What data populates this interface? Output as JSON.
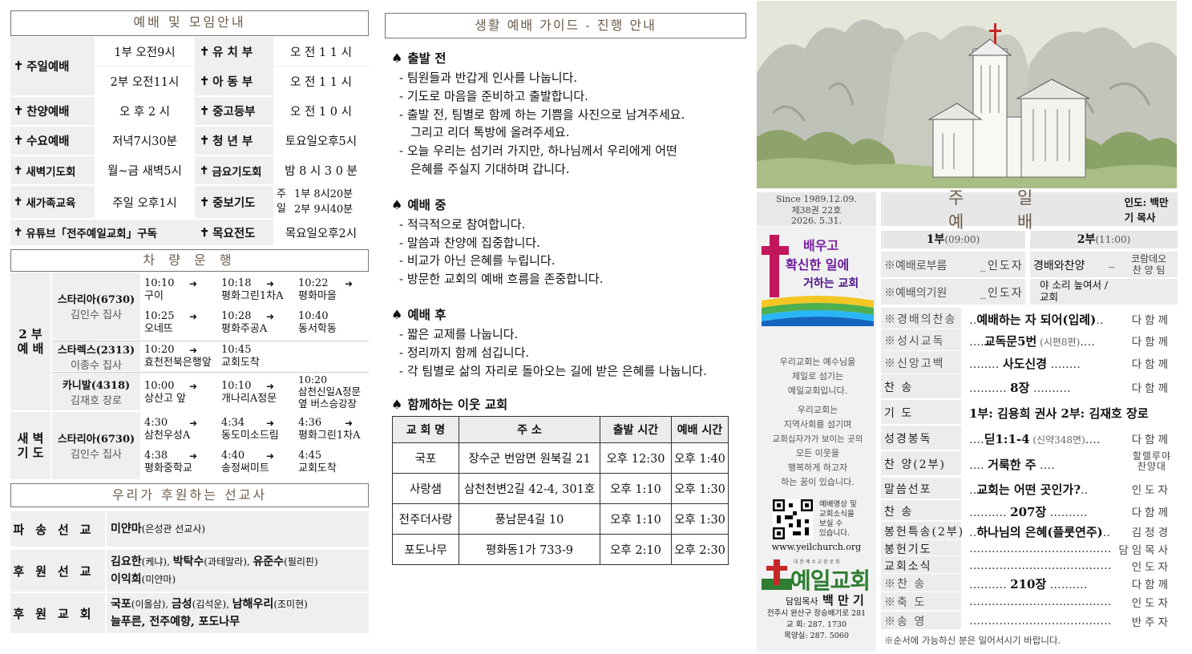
{
  "schedule": {
    "title": "예배 및 모임안내",
    "rows": [
      {
        "a_label": "주일예배",
        "a_val1": "1부  오전9시",
        "a_val2": "2부  오전11시",
        "b1_label": "유 치 부",
        "b1_val": "오 전 1 1 시",
        "b2_label": "아 동 부",
        "b2_val": "오 전 1 1 시"
      },
      {
        "a_label": "찬양예배",
        "a_val": "오  후  2  시",
        "b_label": "중고등부",
        "b_val": "오 전 1 0 시"
      },
      {
        "a_label": "수요예배",
        "a_val": "저녁7시30분",
        "b_label": "청 년 부",
        "b_val": "토요일오후5시"
      },
      {
        "a_label": "새벽기도회",
        "a_val": "월~금 새벽5시",
        "b_label": "금요기도회",
        "b_val": "밤 8 시 3 0 분"
      },
      {
        "a_label": "새가족교육",
        "a_val": "주일  오후1시",
        "b_label": "중보기도",
        "b_val_left": "주일",
        "b_val1": "1부  8시20분",
        "b_val2": "2부  9시40분"
      },
      {
        "a_label": "유튜브「전주예일교회」구독",
        "b_label": "목요전도",
        "b_val": "목요일오후2시"
      }
    ],
    "cross": "✝"
  },
  "bus": {
    "title": "차 량 운 행",
    "arrow": "➜",
    "section1_label": "2 부\n예 배",
    "section2_label": "새 벽\n기 도",
    "routes": [
      {
        "car": "스타리아(6730)",
        "driver": "김인수 집사",
        "stops": [
          [
            "10:10",
            "구이"
          ],
          [
            "10:18",
            "평화그린1차A"
          ],
          [
            "10:22",
            "평화마을"
          ],
          [
            "10:25",
            "오네뜨"
          ],
          [
            "10:28",
            "평화주공A"
          ],
          [
            "10:40",
            "동서학동"
          ]
        ]
      },
      {
        "car": "스타렉스(2313)",
        "driver": "이종수 집사",
        "stops": [
          [
            "10:20",
            "효천전북은행앞"
          ],
          [
            "10:45",
            "교회도착"
          ]
        ]
      },
      {
        "car": "카니발(4318)",
        "driver": "김재호 장로",
        "stops": [
          [
            "10:00",
            "상산고 앞"
          ],
          [
            "10:10",
            "개나리A정문"
          ],
          [
            "10:20",
            "삼천신일A정문 옆 버스승강장"
          ]
        ]
      },
      {
        "car": "스타리아(6730)",
        "driver": "김인수 집사",
        "stops": [
          [
            "4:30",
            "삼천우성A"
          ],
          [
            "4:34",
            "동도미소드림"
          ],
          [
            "4:36",
            "평화그린1차A"
          ],
          [
            "4:38",
            "평화중학교"
          ],
          [
            "4:40",
            "송정써미트"
          ],
          [
            "4:45",
            "교회도착"
          ]
        ]
      }
    ]
  },
  "missionaries": {
    "title": "우리가 후원하는 선교사",
    "rows": [
      {
        "label": "파송선교",
        "html_lines": [
          [
            [
              "미얀마",
              true
            ],
            [
              "(은성관 선교사)",
              false
            ]
          ]
        ]
      },
      {
        "label": "후원선교",
        "html_lines": [
          [
            [
              "김요한",
              true
            ],
            [
              "(케냐), ",
              false
            ],
            [
              "박탁수",
              true
            ],
            [
              "(과테말라), ",
              false
            ],
            [
              "유준수",
              true
            ],
            [
              "(필리핀)",
              false
            ]
          ],
          [
            [
              "이익희",
              true
            ],
            [
              "(미얀마)",
              false
            ]
          ]
        ]
      },
      {
        "label": "후원교회",
        "html_lines": [
          [
            [
              "국포",
              true
            ],
            [
              "(이올삼), ",
              false
            ],
            [
              "금성",
              true
            ],
            [
              "(김석운), ",
              false
            ],
            [
              "남해우리",
              true
            ],
            [
              "(조미현)",
              false
            ]
          ],
          [
            [
              "늘푸른, 전주예향, 포도나무",
              true
            ]
          ]
        ]
      }
    ]
  },
  "guide": {
    "title": "생활 예배 가이드 - 진행 안내",
    "spade": "♠",
    "sections": [
      {
        "head": "출발 전",
        "lines": [
          "- 팀원들과 반갑게 인사를 나눕니다.",
          "- 기도로 마음을 준비하고 출발합니다.",
          "- 출발 전, 팀별로 함께 하는 기쁨을 사진으로 남겨주세요.",
          "그리고 리더 톡방에 올려주세요.",
          "- 오늘 우리는 섬기러 가지만, 하나님께서 우리에게 어떤",
          "은혜를 주실지 기대하며 갑니다."
        ]
      },
      {
        "head": "예배 중",
        "lines": [
          "- 적극적으로 참여합니다.",
          "- 말씀과 찬양에 집중합니다.",
          "- 비교가 아닌 은혜를 누립니다.",
          "- 방문한 교회의 예배 흐름을 존중합니다."
        ]
      },
      {
        "head": "예배 후",
        "lines": [
          "- 짧은 교제를 나눕니다.",
          "- 정리까지 함께 섬깁니다.",
          "- 각 팀별로 삶의 자리로 돌아오는 길에 받은 은혜를 나눕니다."
        ]
      },
      {
        "head": "함께하는 이웃 교회",
        "lines": []
      }
    ],
    "table": {
      "headers": [
        "교 회 명",
        "주    소",
        "출발 시간",
        "예배 시간"
      ],
      "rows": [
        [
          "국포",
          "장수군 번암면 원북길 21",
          "오후 12:30",
          "오후 1:40"
        ],
        [
          "사랑샘",
          "삼천천변2길 42-4, 301호",
          "오후 1:10",
          "오후 1:30"
        ],
        [
          "전주더사랑",
          "풍남문4길 10",
          "오후 1:10",
          "오후 1:30"
        ],
        [
          "포도나무",
          "평화동1가 733-9",
          "오후 2:10",
          "오후 2:30"
        ]
      ]
    }
  },
  "bulletin": {
    "since": "Since 1989.12.09.",
    "volume": "제38권 22호",
    "date": "2026. 5.31.",
    "slogan_l1": "배우고",
    "slogan_l2": "확신한 일에",
    "slogan_l3": "거하는 교회",
    "intro": [
      "우리교회는 예수님을",
      "제일로 섬기는",
      "예일교회입니다.",
      "우리교회는",
      "지역사회를 섬기며",
      "교회십자가가 보이는 곳의",
      "모든 이웃을",
      "행복하게 하고자",
      "하는 꿈이 있습니다."
    ],
    "qr_text": [
      "예배영상 및",
      "교회소식을",
      "보실 수",
      "있습니다."
    ],
    "url": "www.yeilchurch.org",
    "church_sub": "대 한 예 수 교 장 로 회",
    "church_name": "예일교회",
    "pastor_label": "담임목사",
    "pastor_name": "백 만 기",
    "address": "전주시 완산구 장승배기로 281",
    "tel_church": "교    회:  287. 1730",
    "tel_pastor": "목양실:  287. 5060"
  },
  "order": {
    "title": "주 일 예 배",
    "leader": "인도: 백만기 목사",
    "part1": "1부",
    "part1_time": "(09:00)",
    "part2": "2부",
    "part2_time": "(11:00)",
    "r1_name": "※예배로부름",
    "r1_who": "_인도자",
    "r1_name2": "경배와찬양",
    "r1_dash": "_",
    "r1_who2a": "코람데오",
    "r1_who2b": "찬 양 팀",
    "r2_name": "※예배의기원",
    "r2_who": "_인도자",
    "r2_text_a": "야 소리 높여서 /",
    "r2_text_b": "교회",
    "items": [
      {
        "name": "※경배의찬송",
        "pre": "‥",
        "content": "예배하는 자 되어(입례)",
        "sub": "",
        "post": "‥",
        "who": "다함께"
      },
      {
        "name": "※성시교독",
        "pre": "‥‥",
        "content": "교독문5번",
        "sub": " (시편8편)",
        "post": "‥‥",
        "who": "다함께"
      },
      {
        "name": "※신앙고백",
        "pre": "‥‥‥‥ ",
        "content": "사도신경",
        "sub": "",
        "post": " ‥‥‥‥",
        "who": "다함께"
      },
      {
        "name": "찬        송",
        "pre": "‥‥‥‥‥  ",
        "content": "8장",
        "sub": "",
        "post": "  ‥‥‥‥‥",
        "who": "다함께"
      },
      {
        "name": "기        도",
        "pre": "",
        "content": "1부: 김용희 권사    2부: 김재호 장로",
        "sub": "",
        "post": "",
        "who": ""
      },
      {
        "name": "성경봉독",
        "pre": "‥‥",
        "content": "딛1:1-4",
        "sub": " (신약348면)",
        "post": "‥‥",
        "who": "다함께"
      },
      {
        "name": "찬  양(2부)",
        "pre": "‥‥ ",
        "content": "거룩한  주",
        "sub": "",
        "post": " ‥‥",
        "who": "할렐루야\n찬양대"
      },
      {
        "name": "말씀선포",
        "pre": "‥",
        "content": "교회는 어떤 곳인가?",
        "sub": "",
        "post": "‥",
        "who": "인도자"
      },
      {
        "name": "찬        송",
        "pre": "‥‥‥‥‥  ",
        "content": "207장",
        "sub": "",
        "post": "  ‥‥‥‥‥",
        "who": "다함께"
      },
      {
        "name": "봉헌특송(2부)",
        "pre": "‥",
        "content": "하나님의 은혜(플룻연주)",
        "sub": "",
        "post": "‥",
        "who": "김정경"
      },
      {
        "name": "봉헌기도",
        "pre": "‥‥‥‥‥‥‥‥‥‥‥‥‥‥‥‥‥‥‥",
        "content": "",
        "sub": "",
        "post": "",
        "who": "담임목사"
      },
      {
        "name": "교회소식",
        "pre": "‥‥‥‥‥‥‥‥‥‥‥‥‥‥‥‥‥‥‥",
        "content": "",
        "sub": "",
        "post": "",
        "who": "인도자"
      },
      {
        "name": "※찬        송",
        "pre": "‥‥‥‥‥  ",
        "content": "210장",
        "sub": "",
        "post": "  ‥‥‥‥‥",
        "who": "다함께"
      },
      {
        "name": "※축        도",
        "pre": "‥‥‥‥‥‥‥‥‥‥‥‥‥‥‥‥‥‥‥",
        "content": "",
        "sub": "",
        "post": "",
        "who": "인도자"
      },
      {
        "name": "※송        영",
        "pre": "‥‥‥‥‥‥‥‥‥‥‥‥‥‥‥‥‥‥‥",
        "content": "",
        "sub": "",
        "post": "",
        "who": "반주자"
      }
    ],
    "footnote": "※순서에 가능하신 분은 일어서시기 바랍니다."
  }
}
